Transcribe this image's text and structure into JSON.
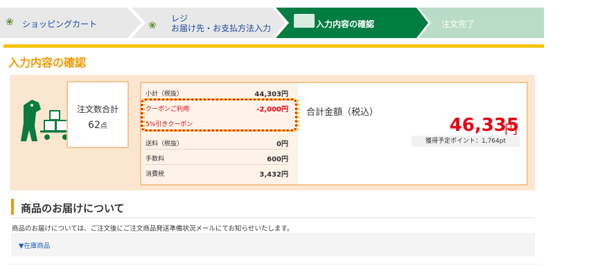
{
  "steps": [
    {
      "label": "ショッピングカート",
      "state": "done"
    },
    {
      "label_line1": "レジ",
      "label_line2": "お届け先・お支払方法入力",
      "state": "done"
    },
    {
      "label": "入力内容の確認",
      "state": "current"
    },
    {
      "label": "注文完了",
      "state": "todo"
    }
  ],
  "colors": {
    "accent": "#f39800",
    "current_step": "#007d40",
    "todo_step": "#b9dcc7",
    "done_step": "#e8e8e8",
    "price_red": "#e60012",
    "yellow": "#f6c500"
  },
  "page_title": "入力内容の確認",
  "order": {
    "count_label": "注文数合計",
    "count_value": "62",
    "count_unit": "点",
    "rows": [
      {
        "label": "小計（税抜）",
        "amount": "44,303円"
      },
      {
        "label": "クーポンご利用",
        "amount": "-2,000円"
      },
      {
        "label": "5%引きクーポン",
        "amount": ""
      },
      {
        "label": "送料（税抜）",
        "amount": "0円"
      },
      {
        "label": "手数料",
        "amount": "600円"
      },
      {
        "label": "消費税",
        "amount": "3,432円"
      }
    ],
    "total_label": "合計金額（税込）",
    "total_amount": "46,335",
    "total_unit": "円",
    "points": "獲得予定ポイント：1,764pt"
  },
  "delivery": {
    "title": "商品のお届けについて",
    "notice": "商品のお届けについては、ご注文後にご注文商品発送準備状況メールにてお知らせいたします。",
    "stock_link": "▼在庫商品"
  }
}
